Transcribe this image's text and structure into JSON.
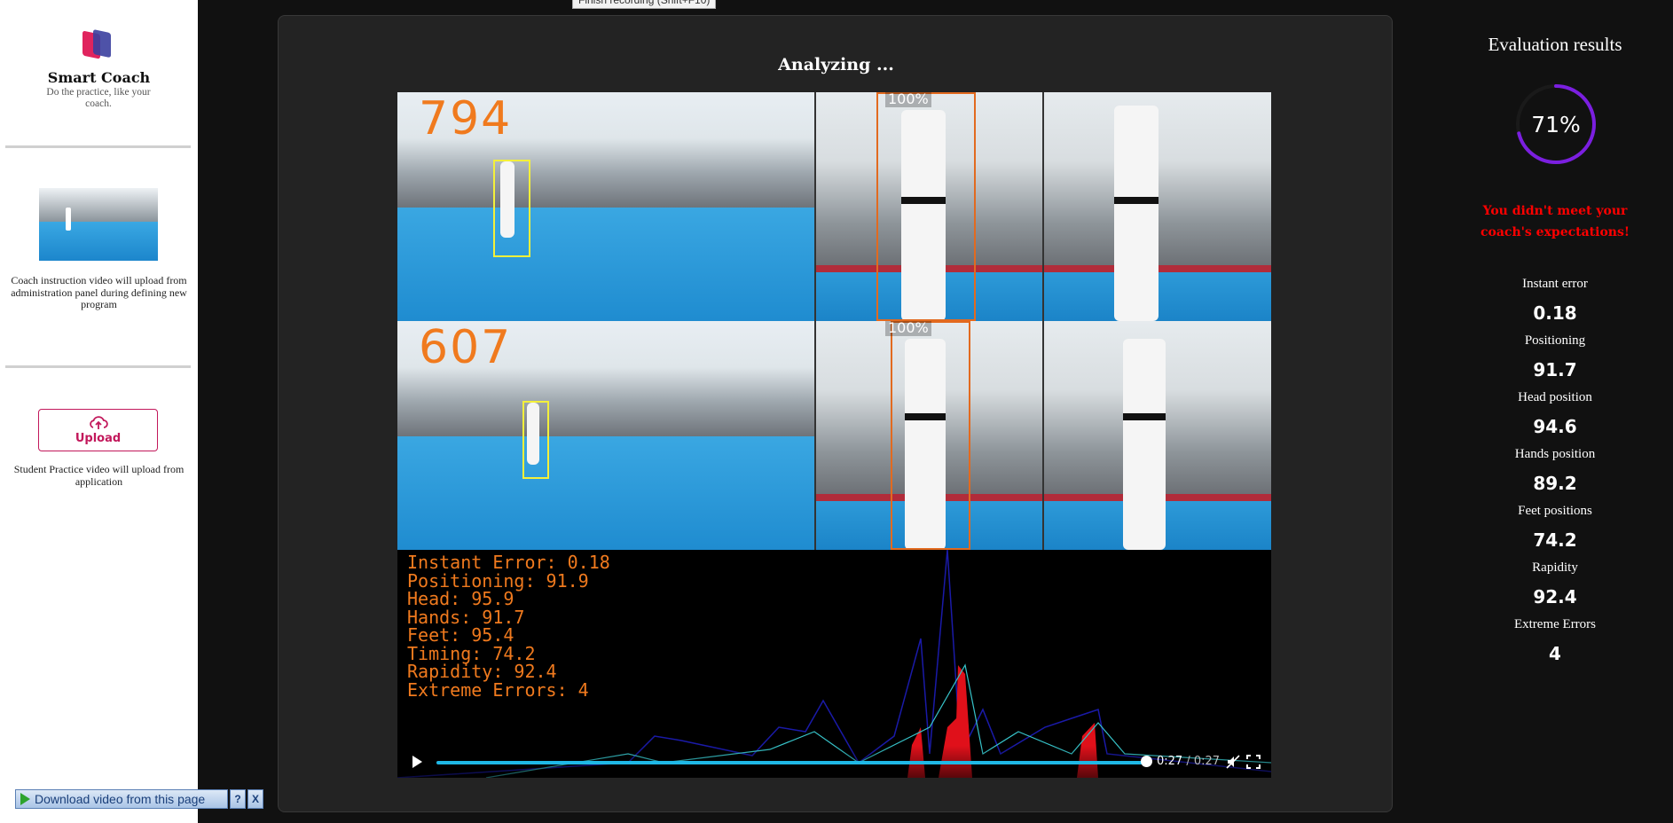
{
  "tooltip": "Finish recording (Shift+F10)",
  "sidebar": {
    "brand": "Smart Coach",
    "tagline": "Do the practice, like your coach.",
    "coach_note": "Coach instruction video will upload from administration panel during defining new program",
    "upload_label": "Upload",
    "student_note": "Student Practice video will upload from application"
  },
  "download_bar": {
    "label": "Download video from this page",
    "help": "?",
    "close": "X"
  },
  "panel": {
    "title": "Analyzing ..."
  },
  "video": {
    "coach_frame_count": "794",
    "student_frame_count": "607",
    "coach_confidence": "100%",
    "student_confidence": "100%",
    "overlay": {
      "instant_error": "Instant Error: 0.18",
      "positioning": "Positioning: 91.9",
      "head": "Head: 95.9",
      "hands": "Hands: 91.7",
      "feet": "Feet: 95.4",
      "timing": "Timing: 74.2",
      "rapidity": "Rapidity: 92.4",
      "extreme_errors": "Extreme Errors: 4"
    },
    "current_time": "0:27",
    "separator": " / ",
    "duration": "0:27",
    "progress": 1.0
  },
  "results": {
    "title": "Evaluation results",
    "score": "71%",
    "score_fraction": 0.71,
    "warning": "You didn't meet your coach's expectations!",
    "metrics": [
      {
        "label": "Instant error",
        "value": "0.18"
      },
      {
        "label": "Positioning",
        "value": "91.7"
      },
      {
        "label": "Head position",
        "value": "94.6"
      },
      {
        "label": "Hands position",
        "value": "89.2"
      },
      {
        "label": "Feet positions",
        "value": "74.2"
      },
      {
        "label": "Rapidity",
        "value": "92.4"
      },
      {
        "label": "Extreme Errors",
        "value": "4"
      }
    ]
  },
  "colors": {
    "accent_pink": "#c2185b",
    "warning_red": "#ff0000",
    "overlay_orange": "#f07a1e",
    "seek_blue": "#1fb8e6",
    "gauge_purple": "#7b1fe0"
  }
}
